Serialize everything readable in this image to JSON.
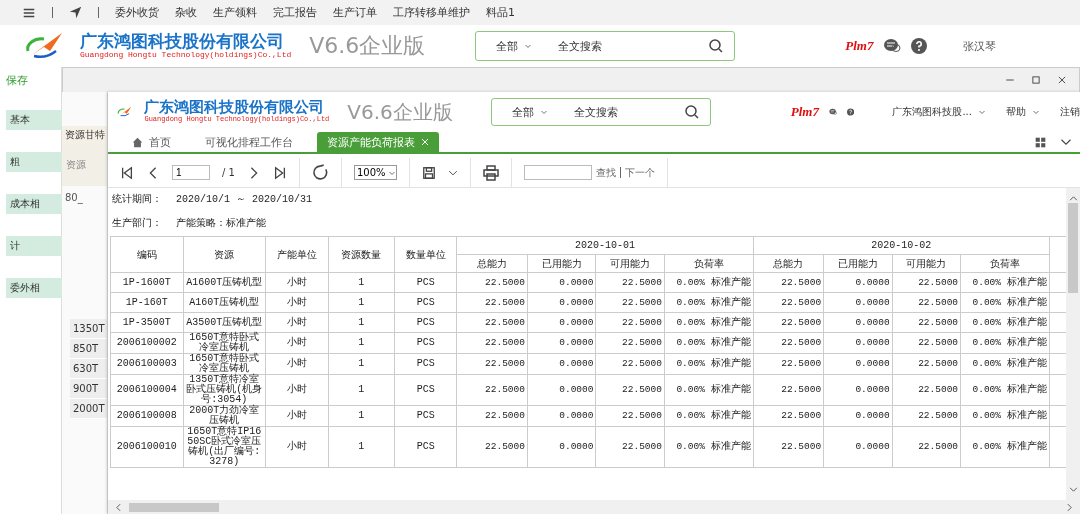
{
  "quick_bar": {
    "items": [
      "委外收货",
      "杂收",
      "生产领料",
      "完工报告",
      "生产订单",
      "工序转移单维护",
      "料品1"
    ]
  },
  "back_header": {
    "company_cn": "广东鸿图科技股份有限公司",
    "company_en": "Guangdong Hongtu Technology(holdings)Co.,Ltd",
    "version": "V6.6企业版",
    "search": {
      "scope": "全部",
      "placeholder": "全文搜索"
    },
    "plm_label": "Plm7",
    "user": "张汉琴"
  },
  "sidebar": {
    "action": "保存",
    "groups": [
      "基本",
      "粗",
      "成本相",
      "计",
      "委外相"
    ]
  },
  "middle_panel": {
    "title": "资源甘特",
    "column": "资源",
    "folder": "80_",
    "rows": [
      "1350T",
      "850T",
      "630T",
      "900T",
      "2000T"
    ]
  },
  "front": {
    "company_cn": "广东鸿图科技股份有限公司",
    "company_en": "Guangdong Hongtu Technology(holdings)Co.,Ltd",
    "version": "V6.6企业版",
    "search": {
      "scope": "全部",
      "placeholder": "全文搜索"
    },
    "plm_label": "Plm7",
    "menus": [
      "广东鸿图科技股...",
      "帮助",
      "注销"
    ],
    "tabs": [
      {
        "label": "首页",
        "kind": "home",
        "selected": false
      },
      {
        "label": "可视化排程工作台",
        "kind": "plain",
        "selected": false
      },
      {
        "label": "资源产能负荷报表",
        "kind": "closable",
        "selected": true
      }
    ],
    "toolbar": {
      "page": "1",
      "page_total": "/ 1",
      "zoom": "100%",
      "find": "查找",
      "next": "下一个"
    },
    "report": {
      "period_label": "统计期间：",
      "period": "2020/10/1 ～ 2020/10/31",
      "dept_label": "生产部门：",
      "strategy": "产能策略：标准产能",
      "columns": [
        "编码",
        "资源",
        "产能单位",
        "资源数量",
        "数量单位"
      ],
      "date_groups": [
        {
          "date": "2020-10-01",
          "columns": [
            "总能力",
            "已用能力",
            "可用能力",
            "负荷率"
          ]
        },
        {
          "date": "2020-10-02",
          "columns": [
            "总能力",
            "已用能力",
            "可用能力",
            "负荷率"
          ]
        }
      ],
      "rows": [
        {
          "cells": [
            "1P-1600T",
            "A1600T压铸机型",
            "小时",
            "1",
            "PCS",
            "22.5000",
            "0.0000",
            "22.5000",
            "0.00% 标准产能",
            "22.5000",
            "0.0000",
            "22.5000",
            "0.00% 标准产能"
          ]
        },
        {
          "cells": [
            "1P-160T",
            "A160T压铸机型",
            "小时",
            "1",
            "PCS",
            "22.5000",
            "0.0000",
            "22.5000",
            "0.00% 标准产能",
            "22.5000",
            "0.0000",
            "22.5000",
            "0.00% 标准产能"
          ]
        },
        {
          "cells": [
            "1P-3500T",
            "A3500T压铸机型",
            "小时",
            "1",
            "PCS",
            "22.5000",
            "0.0000",
            "22.5000",
            "0.00% 标准产能",
            "22.5000",
            "0.0000",
            "22.5000",
            "0.00% 标准产能"
          ]
        },
        {
          "cells": [
            "2006100002",
            "1650T意特卧式冷室压铸机",
            "小时",
            "1",
            "PCS",
            "22.5000",
            "0.0000",
            "22.5000",
            "0.00% 标准产能",
            "22.5000",
            "0.0000",
            "22.5000",
            "0.00% 标准产能"
          ]
        },
        {
          "cells": [
            "2006100003",
            "1650T意特卧式冷室压铸机",
            "小时",
            "1",
            "PCS",
            "22.5000",
            "0.0000",
            "22.5000",
            "0.00% 标准产能",
            "22.5000",
            "0.0000",
            "22.5000",
            "0.00% 标准产能"
          ]
        },
        {
          "cells": [
            "2006100004",
            "1350T意特冷室卧式压铸机(机身号:3054)",
            "小时",
            "1",
            "PCS",
            "22.5000",
            "0.0000",
            "22.5000",
            "0.00% 标准产能",
            "22.5000",
            "0.0000",
            "22.5000",
            "0.00% 标准产能"
          ]
        },
        {
          "cells": [
            "2006100008",
            "2000T力劲冷室压铸机",
            "小时",
            "1",
            "PCS",
            "22.5000",
            "0.0000",
            "22.5000",
            "0.00% 标准产能",
            "22.5000",
            "0.0000",
            "22.5000",
            "0.00% 标准产能"
          ]
        },
        {
          "cells": [
            "2006100010",
            "1650T意特IP1650SC卧式冷室压铸机(出厂编号:3278)",
            "小时",
            "1",
            "PCS",
            "22.5000",
            "0.0000",
            "22.5000",
            "0.00% 标准产能",
            "22.5000",
            "0.0000",
            "22.5000",
            "0.00% 标准产能"
          ]
        }
      ]
    }
  }
}
